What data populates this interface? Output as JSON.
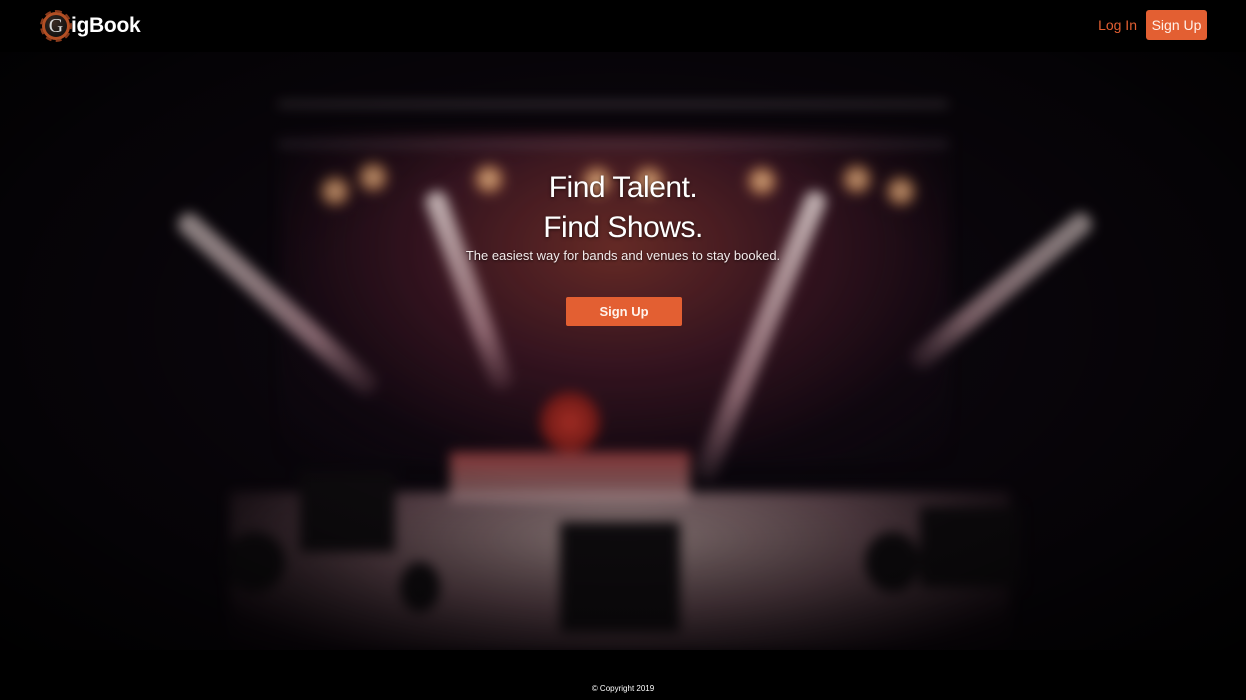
{
  "nav": {
    "brand_mark": "G",
    "brand_name": "igBook",
    "login_label": "Log In",
    "signup_label": "Sign Up"
  },
  "hero": {
    "headline_line1": "Find Talent.",
    "headline_line2": "Find Shows.",
    "tagline": "The easiest way for bands and venues to stay booked.",
    "cta_label": "Sign Up"
  },
  "footer": {
    "copyright": "© Copyright 2019"
  },
  "colors": {
    "accent": "#e35f32",
    "background": "#000000",
    "text": "#ffffff"
  },
  "icons": {
    "logo": "gigbook-logo-icon"
  }
}
